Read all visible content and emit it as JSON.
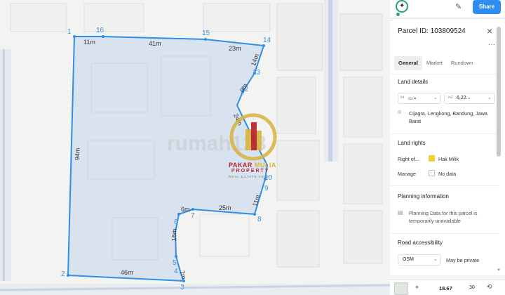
{
  "map": {
    "vertex_labels": [
      "1",
      "16",
      "15",
      "14",
      "13",
      "12",
      "11",
      "10",
      "9",
      "8",
      "7",
      "6",
      "5",
      "4",
      "3",
      "2"
    ],
    "segment_labels": [
      "11m",
      "41m",
      "23m",
      "14m",
      "9m",
      "24m",
      "11m",
      "25m",
      "6m",
      "16m",
      "7m",
      "46m",
      "94m"
    ],
    "watermark": {
      "brand": "PAKAR",
      "brand2": "MULIA",
      "brand3": "PROPERTY",
      "tagline": "REAL ESTATE AGENT",
      "ghost_text": "rumah123"
    },
    "colors": {
      "boundary": "#2f8fe6",
      "fill": "#a9c6ea",
      "vertex": "#3d8fe0"
    }
  },
  "topbar": {
    "avatar_icon": "sparkle-icon",
    "pin_icon": "pin-icon",
    "share_label": "Share"
  },
  "panel": {
    "title": "Parcel ID: 103809524",
    "close_icon": "×",
    "more_icon": "···",
    "tabs": [
      "General",
      "Market",
      "Rundown"
    ],
    "land_details": {
      "title": "Land details",
      "lot_chip": {
        "prefix": "lot",
        "value": "▭ ▪",
        "chev": "⌄"
      },
      "area_chip": {
        "prefix": "m2",
        "value": "6,22...",
        "chev": "⌄"
      },
      "location": "Cijagra, Lengkong, Bandung, Jawa Barat"
    },
    "land_rights": {
      "title": "Land rights",
      "rows": [
        {
          "key": "Right of...",
          "value": "Hak Milik",
          "swatch": "#f4d233"
        },
        {
          "key": "Manage",
          "value": "No data",
          "swatch": "#ffffff"
        }
      ]
    },
    "planning": {
      "title": "Planning information",
      "text": "Planning Data for this parcel is temporarily unavailable"
    },
    "road": {
      "title": "Road accessibility",
      "select_value": "OSM",
      "access": "May be private"
    }
  },
  "bottombar": {
    "zoom": "18.67",
    "degrees": "30",
    "crosshair_icon": "crosshair-icon",
    "rotate_icon": "rotate-icon"
  }
}
